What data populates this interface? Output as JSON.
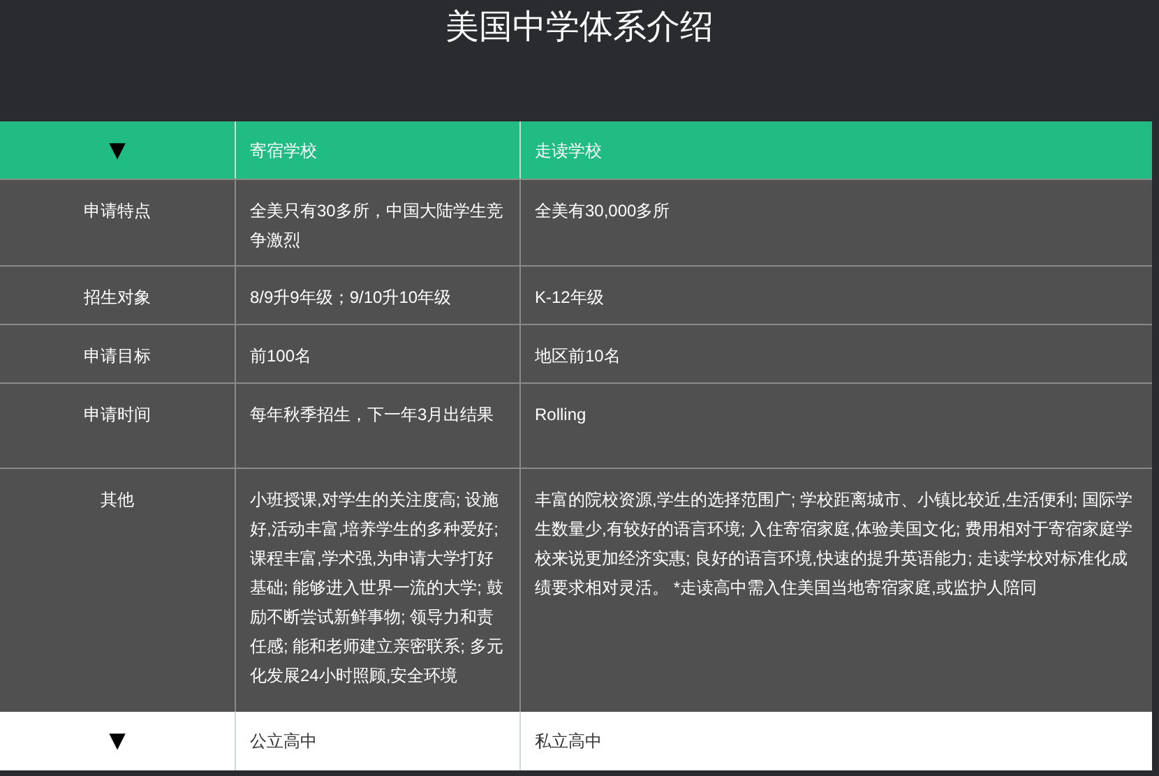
{
  "title": "美国中学体系介绍",
  "sections": [
    {
      "expanded": true,
      "toggle": "▼",
      "columns": [
        "寄宿学校",
        "走读学校"
      ],
      "rows": [
        {
          "label": "申请特点",
          "cells": [
            "全美只有30多所，中国大陆学生竞争激烈",
            "全美有30,000多所"
          ]
        },
        {
          "label": "招生对象",
          "cells": [
            "8/9升9年级；9/10升10年级",
            "K-12年级"
          ]
        },
        {
          "label": "申请目标",
          "cells": [
            "前100名",
            "地区前10名"
          ]
        },
        {
          "label": "申请时间",
          "cells": [
            "每年秋季招生，下一年3月出结果",
            "Rolling"
          ]
        },
        {
          "label": "其他",
          "cells": [
            "小班授课,对学生的关注度高; 设施好,活动丰富,培养学生的多种爱好; 课程丰富,学术强,为申请大学打好基础; 能够进入世界一流的大学; 鼓励不断尝试新鲜事物; 领导力和责任感; 能和老师建立亲密联系; 多元化发展24小时照顾,安全环境",
            "丰富的院校资源,学生的选择范围广; 学校距离城市、小镇比较近,生活便利; 国际学生数量少,有较好的语言环境; 入住寄宿家庭,体验美国文化; 费用相对于寄宿家庭学校来说更加经济实惠; 良好的语言环境,快速的提升英语能力; 走读学校对标准化成绩要求相对灵活。 *走读高中需入住美国当地寄宿家庭,或监护人陪同"
          ]
        }
      ]
    },
    {
      "expanded": false,
      "toggle": "▼",
      "columns": [
        "公立高中",
        "私立高中"
      ]
    }
  ]
}
